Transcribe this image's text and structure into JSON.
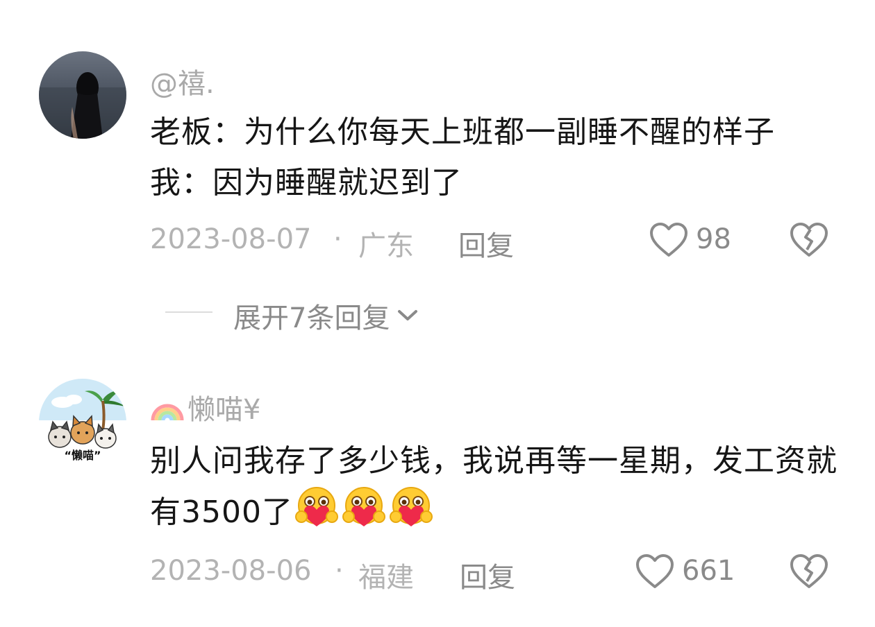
{
  "comments": [
    {
      "username": "@禧.",
      "text": "老板：为什么你每天上班都一副睡不醒的样子　我：因为睡醒就迟到了",
      "date": "2023-08-07",
      "separator": "·",
      "location": "广东",
      "reply_label": "回复",
      "like_count": "98",
      "expand_label": "展开7条回复"
    },
    {
      "username": "懒喵¥",
      "avatar_text": "“懒喵”",
      "text": "别人问我存了多少钱，我说再等一星期，发工资就有3500了",
      "emoji_count": 3,
      "date": "2023-08-06",
      "separator": "·",
      "location": "福建",
      "reply_label": "回复",
      "like_count": "661"
    }
  ],
  "icons": {
    "like": "heart-outline-icon",
    "dislike": "broken-heart-icon",
    "expand": "chevron-down-icon",
    "rainbow": "rainbow-emoji-icon",
    "emoji": "heart-hug-emoji-icon"
  },
  "colors": {
    "text": "#161616",
    "muted": "#a9a9a9",
    "action": "#8a8a8a"
  }
}
